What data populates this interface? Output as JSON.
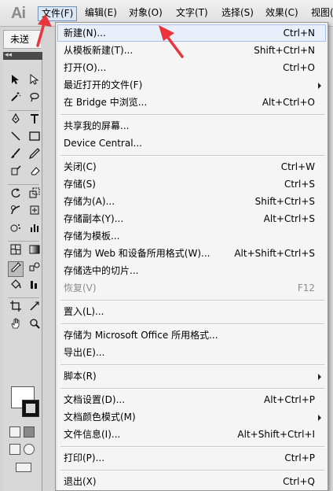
{
  "app": {
    "logo_text": "Ai"
  },
  "menubar": {
    "items": [
      {
        "label": "文件(F)"
      },
      {
        "label": "编辑(E)"
      },
      {
        "label": "对象(O)"
      },
      {
        "label": "文字(T)"
      },
      {
        "label": "选择(S)"
      },
      {
        "label": "效果(C)"
      },
      {
        "label": "视图("
      }
    ]
  },
  "workspace": {
    "doc_tab_label": "未送",
    "collapse_glyph": "◂◂"
  },
  "file_menu": {
    "items": [
      {
        "label": "新建(N)...",
        "shortcut": "Ctrl+N"
      },
      {
        "label": "从模板新建(T)...",
        "shortcut": "Shift+Ctrl+N"
      },
      {
        "label": "打开(O)...",
        "shortcut": "Ctrl+O"
      },
      {
        "label": "最近打开的文件(F)",
        "shortcut": ""
      },
      {
        "label": "在 Bridge 中浏览...",
        "shortcut": "Alt+Ctrl+O"
      },
      {
        "label": "共享我的屏幕...",
        "shortcut": ""
      },
      {
        "label": "Device Central...",
        "shortcut": ""
      },
      {
        "label": "关闭(C)",
        "shortcut": "Ctrl+W"
      },
      {
        "label": "存储(S)",
        "shortcut": "Ctrl+S"
      },
      {
        "label": "存储为(A)...",
        "shortcut": "Shift+Ctrl+S"
      },
      {
        "label": "存储副本(Y)...",
        "shortcut": "Alt+Ctrl+S"
      },
      {
        "label": "存储为模板...",
        "shortcut": ""
      },
      {
        "label": "存储为 Web 和设备所用格式(W)...",
        "shortcut": "Alt+Shift+Ctrl+S"
      },
      {
        "label": "存储选中的切片...",
        "shortcut": ""
      },
      {
        "label": "恢复(V)",
        "shortcut": "F12"
      },
      {
        "label": "置入(L)...",
        "shortcut": ""
      },
      {
        "label": "存储为 Microsoft Office 所用格式...",
        "shortcut": ""
      },
      {
        "label": "导出(E)...",
        "shortcut": ""
      },
      {
        "label": "脚本(R)",
        "shortcut": ""
      },
      {
        "label": "文档设置(D)...",
        "shortcut": "Alt+Ctrl+P"
      },
      {
        "label": "文档颜色模式(M)",
        "shortcut": ""
      },
      {
        "label": "文件信息(I)...",
        "shortcut": "Alt+Shift+Ctrl+I"
      },
      {
        "label": "打印(P)...",
        "shortcut": "Ctrl+P"
      },
      {
        "label": "退出(X)",
        "shortcut": "Ctrl+Q"
      }
    ]
  },
  "colors": {
    "arrow_red": "#e8343a",
    "menu_highlight": "#dbe6f5",
    "disabled_text": "#8d8d8d"
  }
}
